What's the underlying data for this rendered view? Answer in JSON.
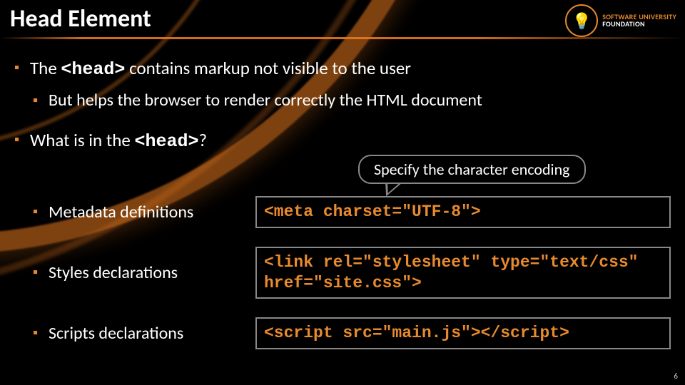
{
  "title": "Head Element",
  "logo": {
    "line1": "SOFTWARE UNIVERSITY",
    "line2": "FOUNDATION",
    "glyph": "💡"
  },
  "bullets": {
    "b1_pre": "The ",
    "b1_code": "<head>",
    "b1_post": " contains markup not visible to the user",
    "b1_sub": "But helps the browser to render correctly the HTML document",
    "b2_pre": "What is in the ",
    "b2_code": "<head>",
    "b2_post": "?"
  },
  "callout": "Specify the character encoding",
  "rows": [
    {
      "label": "Metadata definitions",
      "code": "<meta charset=\"UTF-8\">"
    },
    {
      "label": "Styles declarations",
      "code": "<link rel=\"stylesheet\" type=\"text/css\" href=\"site.css\">"
    },
    {
      "label": "Scripts declarations",
      "code": "<script src=\"main.js\"></script>"
    }
  ],
  "pagenum": "6"
}
